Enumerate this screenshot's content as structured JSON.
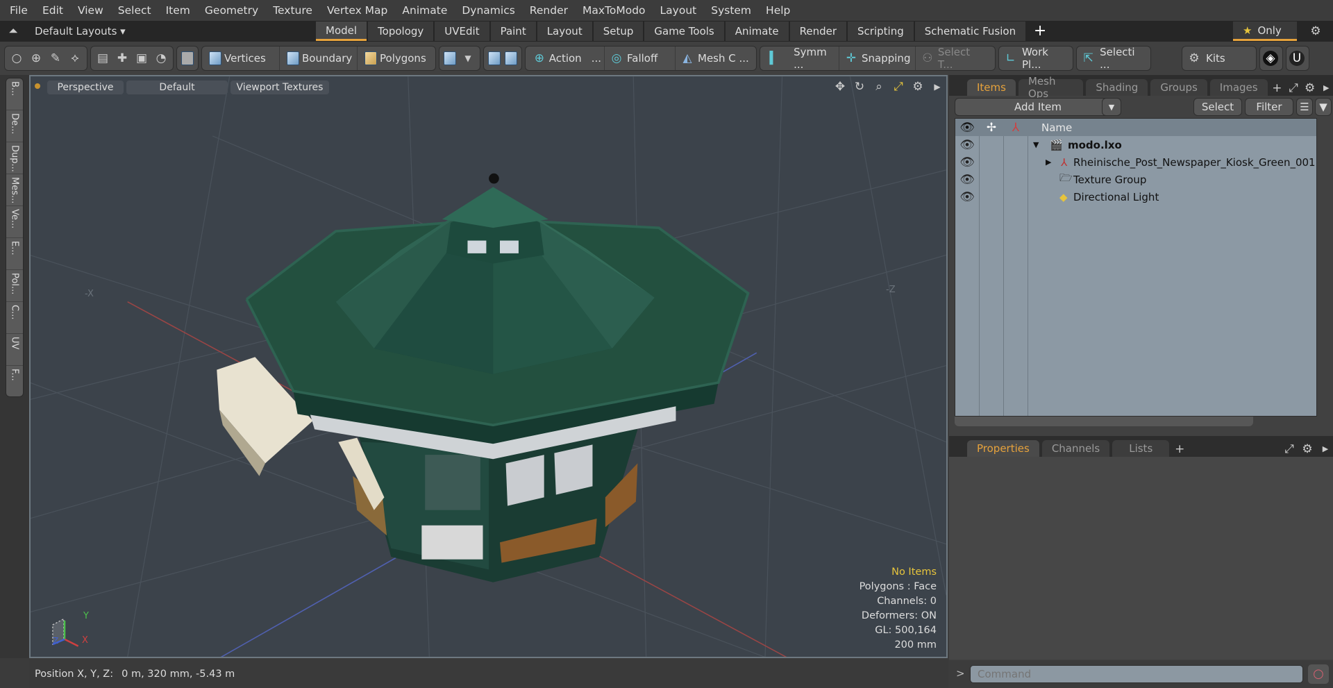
{
  "menu": [
    "File",
    "Edit",
    "View",
    "Select",
    "Item",
    "Geometry",
    "Texture",
    "Vertex Map",
    "Animate",
    "Dynamics",
    "Render",
    "MaxToModo",
    "Layout",
    "System",
    "Help"
  ],
  "layout_selector": "Default Layouts ▾",
  "layout_tabs": [
    "Model",
    "Topology",
    "UVEdit",
    "Paint",
    "Layout",
    "Setup",
    "Game Tools",
    "Animate",
    "Render",
    "Scripting",
    "Schematic Fusion"
  ],
  "only_label": "Only",
  "toolbar": {
    "vertices": "Vertices",
    "boundary": "Boundary",
    "polygons": "Polygons",
    "action": "Action",
    "action_more": "...",
    "falloff": "Falloff",
    "mesh": "Mesh C ...",
    "symm": "Symm ...",
    "snapping": "Snapping",
    "select_t": "Select T...",
    "workplane": "Work Pl...",
    "selection": "Selecti ...",
    "kits": "Kits"
  },
  "left_tabs": [
    "B...",
    "De...",
    "Dup...",
    "Mes...",
    "Ve...",
    "E...",
    "Pol...",
    "C...",
    "UV",
    "F..."
  ],
  "viewport": {
    "view": "Perspective",
    "shading": "Default",
    "textures": "Viewport Textures",
    "axis_x": "X",
    "axis_y": "Y",
    "axis_z": "Z",
    "label_negx": "-X",
    "label_negz": "-Z",
    "info": {
      "selection": "No Items",
      "mode": "Polygons : Face",
      "channels": "Channels: 0",
      "deformers": "Deformers: ON",
      "gl": "GL: 500,164",
      "scale": "200 mm"
    }
  },
  "status": {
    "label": "Position X, Y, Z:",
    "value": "0 m, 320 mm, -5.43 m"
  },
  "items_panel": {
    "tabs": [
      "Items",
      "Mesh Ops",
      "Shading",
      "Groups",
      "Images"
    ],
    "add_item": "Add Item",
    "select": "Select",
    "filter": "Filter",
    "name_header": "Name",
    "rows": [
      {
        "name": "modo.lxo"
      },
      {
        "name": "Rheinische_Post_Newspaper_Kiosk_Green_001"
      },
      {
        "name": "Texture Group"
      },
      {
        "name": "Directional Light"
      }
    ]
  },
  "props_panel": {
    "tabs": [
      "Properties",
      "Channels",
      "Lists"
    ]
  },
  "command": {
    "prompt": ">",
    "placeholder": "Command"
  },
  "colors": {
    "accent": "#e6a23c",
    "roof": "#1f4a3e",
    "viewport_bg": "#3c434b"
  }
}
